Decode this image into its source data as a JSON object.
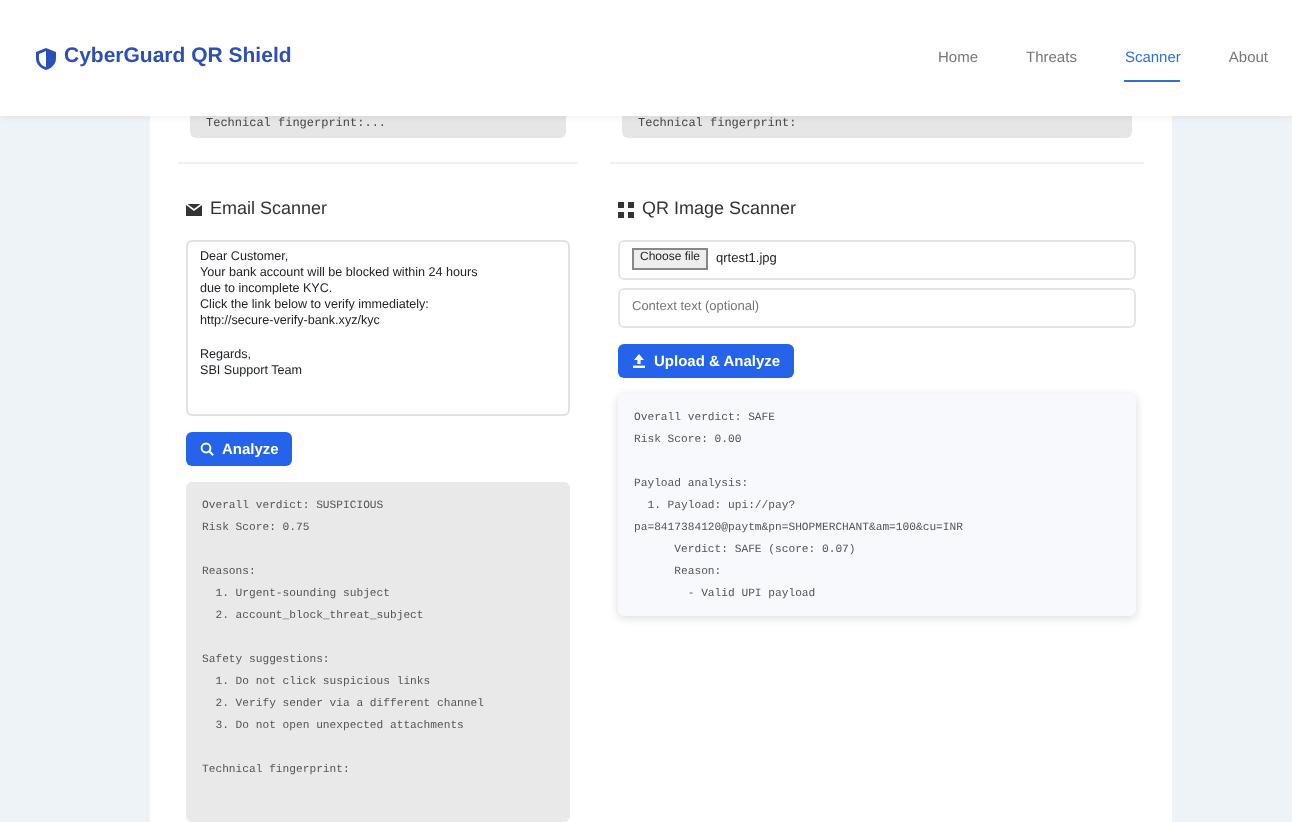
{
  "navbar": {
    "brand": "CyberGuard QR Shield",
    "links": [
      {
        "label": "Home",
        "selected": false
      },
      {
        "label": "Threats",
        "selected": false
      },
      {
        "label": "Scanner",
        "selected": true
      },
      {
        "label": "About",
        "selected": false
      }
    ]
  },
  "top_results": [
    "Technical fingerprint:...",
    "Technical fingerprint:"
  ],
  "email_scanner": {
    "title": "Email Scanner",
    "message": "Dear Customer,\nYour bank account will be blocked within 24 hours\ndue to incomplete KYC.\nClick the link below to verify immediately:\nhttp://secure-verify-bank.xyz/kyc\n\nRegards,\nSBI Support Team",
    "button": "Analyze",
    "result": [
      [
        "Overall verdict: SUSPICIOUS",
        "Risk Score: 0.75"
      ],
      [
        "Reasons:",
        "  1. Urgent-sounding subject",
        "  2. account_block_threat_subject"
      ],
      [
        "Safety suggestions:",
        "  1. Do not click suspicious links",
        "  2. Verify sender via a different channel",
        "  3. Do not open unexpected attachments"
      ],
      [
        "Technical fingerprint:"
      ]
    ]
  },
  "qr_scanner": {
    "title": "QR Image Scanner",
    "file_button": "Choose file",
    "file_name": "qrtest1.jpg",
    "context_placeholder": "Context text (optional)",
    "button": "Upload & Analyze",
    "result": [
      [
        "Overall verdict: SAFE",
        "Risk Score: 0.00"
      ],
      [
        "Payload analysis:",
        "  1. Payload: upi://pay?",
        "pa=8417384120@paytm&pn=SHOPMERCHANT&am=100&cu=INR",
        "      Verdict: SAFE (score: 0.07)",
        "      Reason:",
        "        - Valid UPI payload"
      ]
    ]
  }
}
